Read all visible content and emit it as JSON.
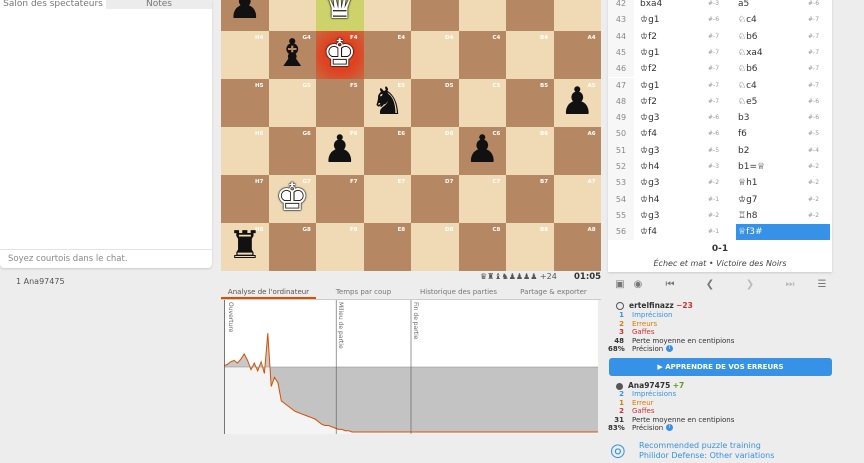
{
  "chat": {
    "tabs": [
      "Salon des spectateurs",
      "Notes"
    ],
    "input_placeholder": "Soyez courtois dans le chat.",
    "spectators": "1  Ana97475"
  },
  "board": {
    "files": [
      "H",
      "G",
      "F",
      "E",
      "D",
      "C",
      "B",
      "A"
    ],
    "rows": [
      "5",
      "4",
      "3",
      "2",
      "1"
    ],
    "pieces": [
      {
        "sq": "H5",
        "glyph": "♟",
        "color": "b",
        "row": 0,
        "col": 0
      },
      {
        "sq": "F5",
        "glyph": "♛",
        "color": "w",
        "row": 0,
        "col": 2
      },
      {
        "sq": "G4",
        "glyph": "♝",
        "color": "b",
        "row": 1,
        "col": 1
      },
      {
        "sq": "F4",
        "glyph": "♚",
        "color": "w",
        "row": 1,
        "col": 2
      },
      {
        "sq": "E3",
        "glyph": "♞",
        "color": "b",
        "row": 2,
        "col": 3
      },
      {
        "sq": "A3",
        "glyph": "♟",
        "color": "b",
        "row": 2,
        "col": 7
      },
      {
        "sq": "F2",
        "glyph": "♟",
        "color": "b",
        "row": 3,
        "col": 2
      },
      {
        "sq": "C2",
        "glyph": "♟",
        "color": "b",
        "row": 3,
        "col": 5
      },
      {
        "sq": "G1",
        "glyph": "♚",
        "color": "w",
        "row": 4,
        "col": 1
      },
      {
        "sq": "H0",
        "glyph": "♜",
        "color": "b",
        "row": 5,
        "col": 0
      }
    ],
    "coords": [
      [
        "H4",
        "G4",
        "F4",
        "E4",
        "D4",
        "C4",
        "B4",
        "A4"
      ],
      [
        "H5",
        "G5",
        "F5",
        "E5",
        "D5",
        "C5",
        "B5",
        "A5"
      ],
      [
        "H6",
        "G6",
        "F6",
        "E6",
        "D6",
        "C6",
        "B6",
        "A6"
      ],
      [
        "H7",
        "G7",
        "F7",
        "E7",
        "D7",
        "C7",
        "B7",
        "A7"
      ],
      [
        "H8",
        "G8",
        "F8",
        "E8",
        "D8",
        "C8",
        "B8",
        "A8"
      ]
    ]
  },
  "material": "♛♜♝♞♟♟♟♟ +24",
  "clock": "01:05",
  "analysis_tabs": [
    "Analyse de l'ordinateur",
    "Temps par coup",
    "Historique des parties",
    "Partage & exporter"
  ],
  "chart_data": {
    "type": "area",
    "phase_labels": [
      "Ouverture",
      "Milieu de partie",
      "Fin de partie"
    ],
    "values": [
      0.1,
      0.2,
      0.4,
      0.5,
      0.3,
      0.6,
      1.0,
      0.5,
      -0.2,
      0.3,
      -0.3,
      0.4,
      -0.5,
      2.6,
      -1.5,
      -0.8,
      -1.2,
      -2.6,
      -2.8,
      -3.0,
      -3.2,
      -3.4,
      -3.5,
      -3.6,
      -3.7,
      -3.8,
      -3.9,
      -4.0,
      -4.2,
      -4.4,
      -4.5,
      -4.5,
      -4.6,
      -4.7,
      -4.8,
      -4.8,
      -4.9,
      -4.9,
      -5.0,
      -5.0,
      -5.0,
      -5.0,
      -5.0,
      -5.0,
      -5.0,
      -5.0,
      -5.0,
      -5.0,
      -5.0,
      -5.0,
      -5.0,
      -5.0,
      -5.0,
      -5.0,
      -5.0,
      -5.0,
      -5.0,
      -5.0,
      -5.0,
      -5.0,
      -5.0,
      -5.0,
      -5.0,
      -5.0,
      -5.0,
      -5.0,
      -5.0,
      -5.0,
      -5.0,
      -5.0,
      -5.0,
      -5.0,
      -5.0,
      -5.0,
      -5.0,
      -5.0,
      -5.0,
      -5.0,
      -5.0,
      -5.0,
      -5.0,
      -5.0,
      -5.0,
      -5.0,
      -5.0,
      -5.0,
      -5.0,
      -5.0,
      -5.0,
      -5.0,
      -5.0,
      -5.0,
      -5.0,
      -5.0,
      -5.0,
      -5.0,
      -5.0,
      -5.0,
      -5.0,
      -5.0,
      -5.0,
      -5.0,
      -5.0,
      -5.0,
      -5.0,
      -5.0,
      -5.0,
      -5.0,
      -5.0,
      -5.0,
      -5.0,
      -5.0
    ],
    "ylim": [
      -5,
      5
    ],
    "phase_divisions": [
      0.3,
      0.5
    ]
  },
  "moves": [
    {
      "n": "42",
      "w": "bxa4",
      "we": "#-3",
      "b": "a5",
      "be": "#-6"
    },
    {
      "n": "43",
      "w": "♔g1",
      "we": "#-6",
      "b": "♘c4",
      "be": "#-7"
    },
    {
      "n": "44",
      "w": "♔f2",
      "we": "#-7",
      "b": "♘b6",
      "be": "#-7"
    },
    {
      "n": "45",
      "w": "♔g1",
      "we": "#-7",
      "b": "♘xa4",
      "be": "#-7"
    },
    {
      "n": "46",
      "w": "♔f2",
      "we": "#-7",
      "b": "♘b6",
      "be": "#-7"
    },
    {
      "n": "47",
      "w": "♔g1",
      "we": "#-7",
      "b": "♘c4",
      "be": "#-7"
    },
    {
      "n": "48",
      "w": "♔f2",
      "we": "#-7",
      "b": "♘e5",
      "be": "#-6"
    },
    {
      "n": "49",
      "w": "♔g3",
      "we": "#-6",
      "b": "b3",
      "be": "#-6"
    },
    {
      "n": "50",
      "w": "♔f4",
      "we": "#-6",
      "b": "f6",
      "be": "#-5"
    },
    {
      "n": "51",
      "w": "♔g3",
      "we": "#-5",
      "b": "b2",
      "be": "#-4"
    },
    {
      "n": "52",
      "w": "♔h4",
      "we": "#-3",
      "b": "b1=♕",
      "be": "#-2"
    },
    {
      "n": "53",
      "w": "♔g3",
      "we": "#-2",
      "b": "♕h1",
      "be": "#-2"
    },
    {
      "n": "54",
      "w": "♔h4",
      "we": "#-1",
      "b": "♔g7",
      "be": "#-2"
    },
    {
      "n": "55",
      "w": "♔g3",
      "we": "#-2",
      "b": "♖h8",
      "be": "#-2"
    },
    {
      "n": "56",
      "w": "♔f4",
      "we": "#-1",
      "b": "♕f3#",
      "be": ""
    }
  ],
  "result": "0-1",
  "result_desc": "Échec et mat • Victoire des Noirs",
  "white_player": {
    "name": "ertelfinazz",
    "rating_diff": "−23",
    "stats": [
      {
        "n": "1",
        "label": "Imprécision",
        "cls": "blue"
      },
      {
        "n": "2",
        "label": "Erreurs",
        "cls": "orange"
      },
      {
        "n": "3",
        "label": "Gaffes",
        "cls": "red"
      },
      {
        "n": "48",
        "label": "Perte moyenne en centipions",
        "cls": ""
      },
      {
        "n": "68%",
        "label": "Précision",
        "cls": ""
      }
    ]
  },
  "learn_button": "APPRENDRE DE VOS ERREURS",
  "black_player": {
    "name": "Ana97475",
    "rating_diff": "+7",
    "stats": [
      {
        "n": "2",
        "label": "Imprécisions",
        "cls": "blue"
      },
      {
        "n": "1",
        "label": "Erreur",
        "cls": "orange"
      },
      {
        "n": "2",
        "label": "Gaffes",
        "cls": "red"
      },
      {
        "n": "31",
        "label": "Perte moyenne en centipions",
        "cls": ""
      },
      {
        "n": "83%",
        "label": "Précision",
        "cls": ""
      }
    ]
  },
  "puzzle": {
    "line1": "Recommended puzzle training",
    "line2": "Philidor Defense: Other variations"
  }
}
